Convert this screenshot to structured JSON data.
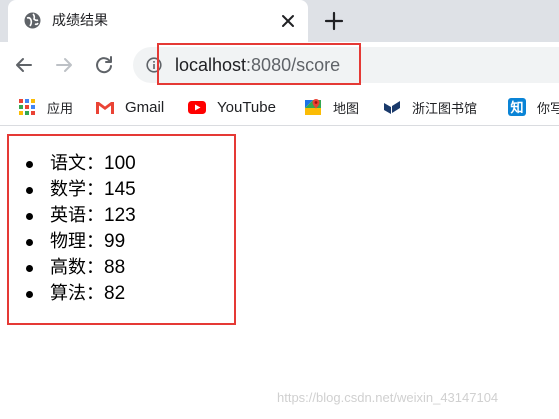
{
  "browser": {
    "tab": {
      "title": "成绩结果",
      "favicon": "globe-icon"
    },
    "new_tab_label": "+",
    "url_host": "localhost",
    "url_rest": ":8080/score",
    "bookmarks": [
      {
        "label": "应用",
        "icon": "apps-grid-icon"
      },
      {
        "label": "Gmail",
        "icon": "gmail-icon"
      },
      {
        "label": "YouTube",
        "icon": "youtube-icon"
      },
      {
        "label": "地图",
        "icon": "maps-icon"
      },
      {
        "label": "浙江图书馆",
        "icon": "library-icon"
      },
      {
        "label": "你写",
        "icon": "zhihu-icon"
      }
    ]
  },
  "page": {
    "scores": [
      {
        "subject": "语文",
        "sep": "：",
        "value": "100"
      },
      {
        "subject": "数学",
        "sep": "：",
        "value": "145"
      },
      {
        "subject": "英语",
        "sep": "：",
        "value": "123"
      },
      {
        "subject": "物理",
        "sep": "：",
        "value": "99"
      },
      {
        "subject": "高数",
        "sep": "：",
        "value": "88"
      },
      {
        "subject": "算法",
        "sep": "：",
        "value": "82"
      }
    ]
  },
  "watermark": "https://blog.csdn.net/weixin_43147104",
  "colors": {
    "highlight": "#e53935",
    "tabstrip": "#dee1e6",
    "omnibox": "#f1f3f4"
  }
}
